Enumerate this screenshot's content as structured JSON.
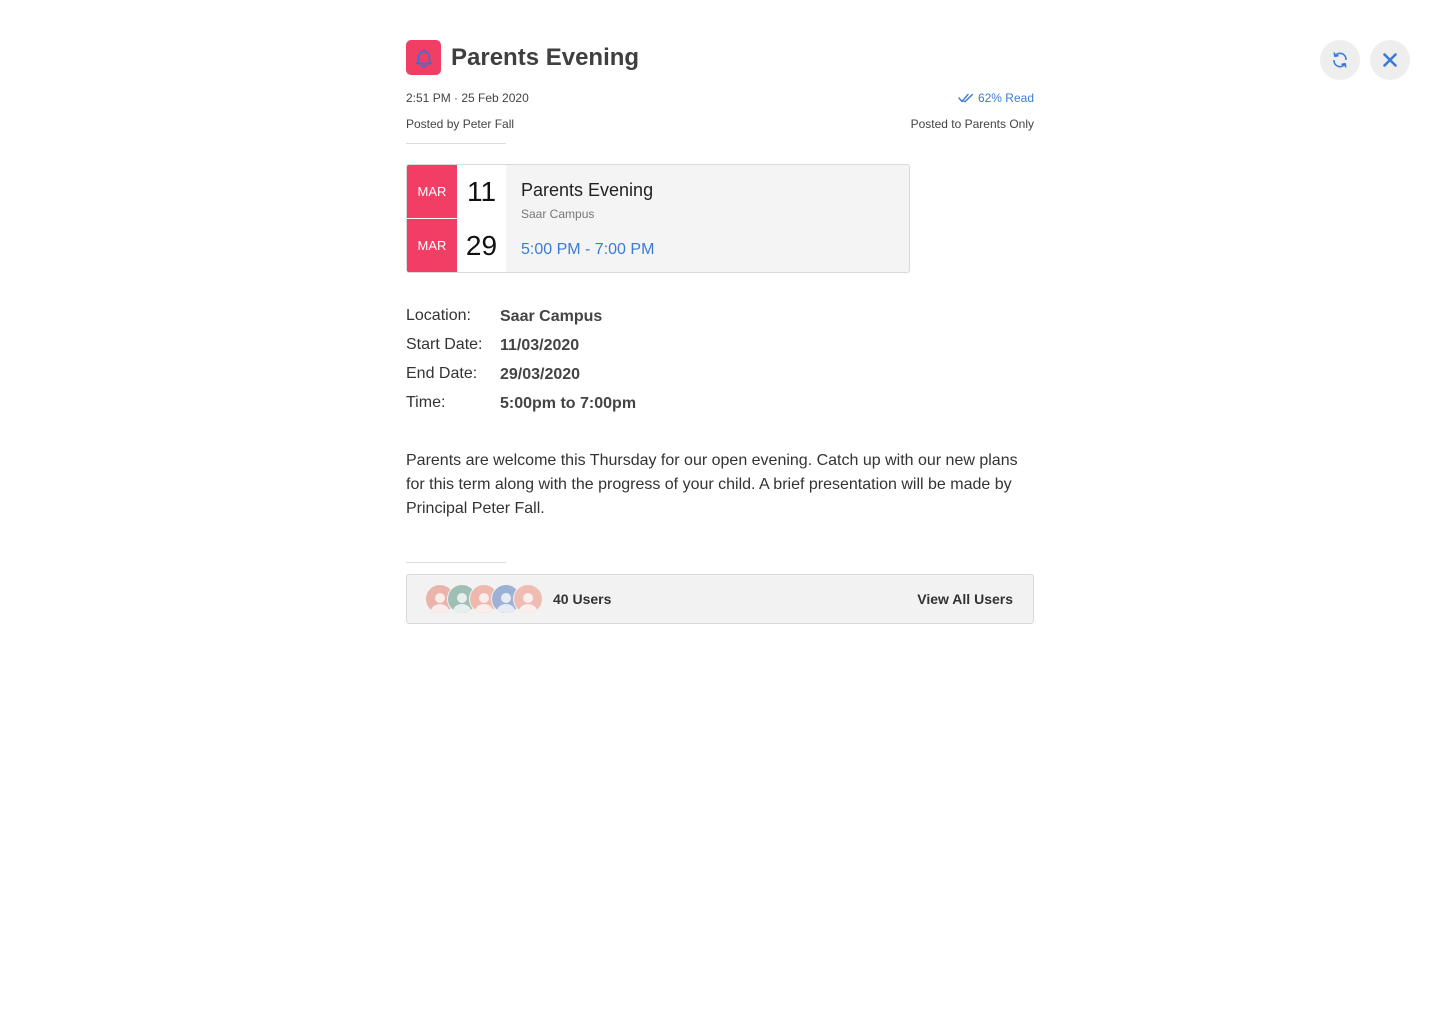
{
  "header": {
    "title": "Parents Evening",
    "icon": "bell-icon",
    "accent_color": "#f23d64"
  },
  "controls": {
    "refresh_icon": "refresh-icon",
    "close_icon": "close-icon"
  },
  "meta": {
    "timestamp": "2:51 PM · 25 Feb 2020",
    "read_status": "62% Read",
    "posted_by": "Posted by Peter Fall",
    "posted_to": "Posted to Parents Only"
  },
  "event": {
    "start_month": "MAR",
    "start_day": "11",
    "end_month": "MAR",
    "end_day": "29",
    "title": "Parents Evening",
    "location": "Saar Campus",
    "time_range": "5:00 PM - 7:00 PM"
  },
  "details": [
    {
      "label": "Location:",
      "value": "Saar Campus"
    },
    {
      "label": "Start Date:",
      "value": "11/03/2020"
    },
    {
      "label": "End Date:",
      "value": "29/03/2020"
    },
    {
      "label": "Time:",
      "value": "5:00pm to 7:00pm"
    }
  ],
  "description": "Parents are welcome this Thursday for our open evening. Catch up with our new plans for this term along with the progress of your child. A brief presentation will be made by Principal Peter Fall.",
  "users": {
    "count_label": "40 Users",
    "view_all_label": "View All Users",
    "avatar_colors": [
      "#e8b4ab",
      "#9fbfb5",
      "#efb8ae",
      "#9db1d6",
      "#efbcb4"
    ]
  }
}
